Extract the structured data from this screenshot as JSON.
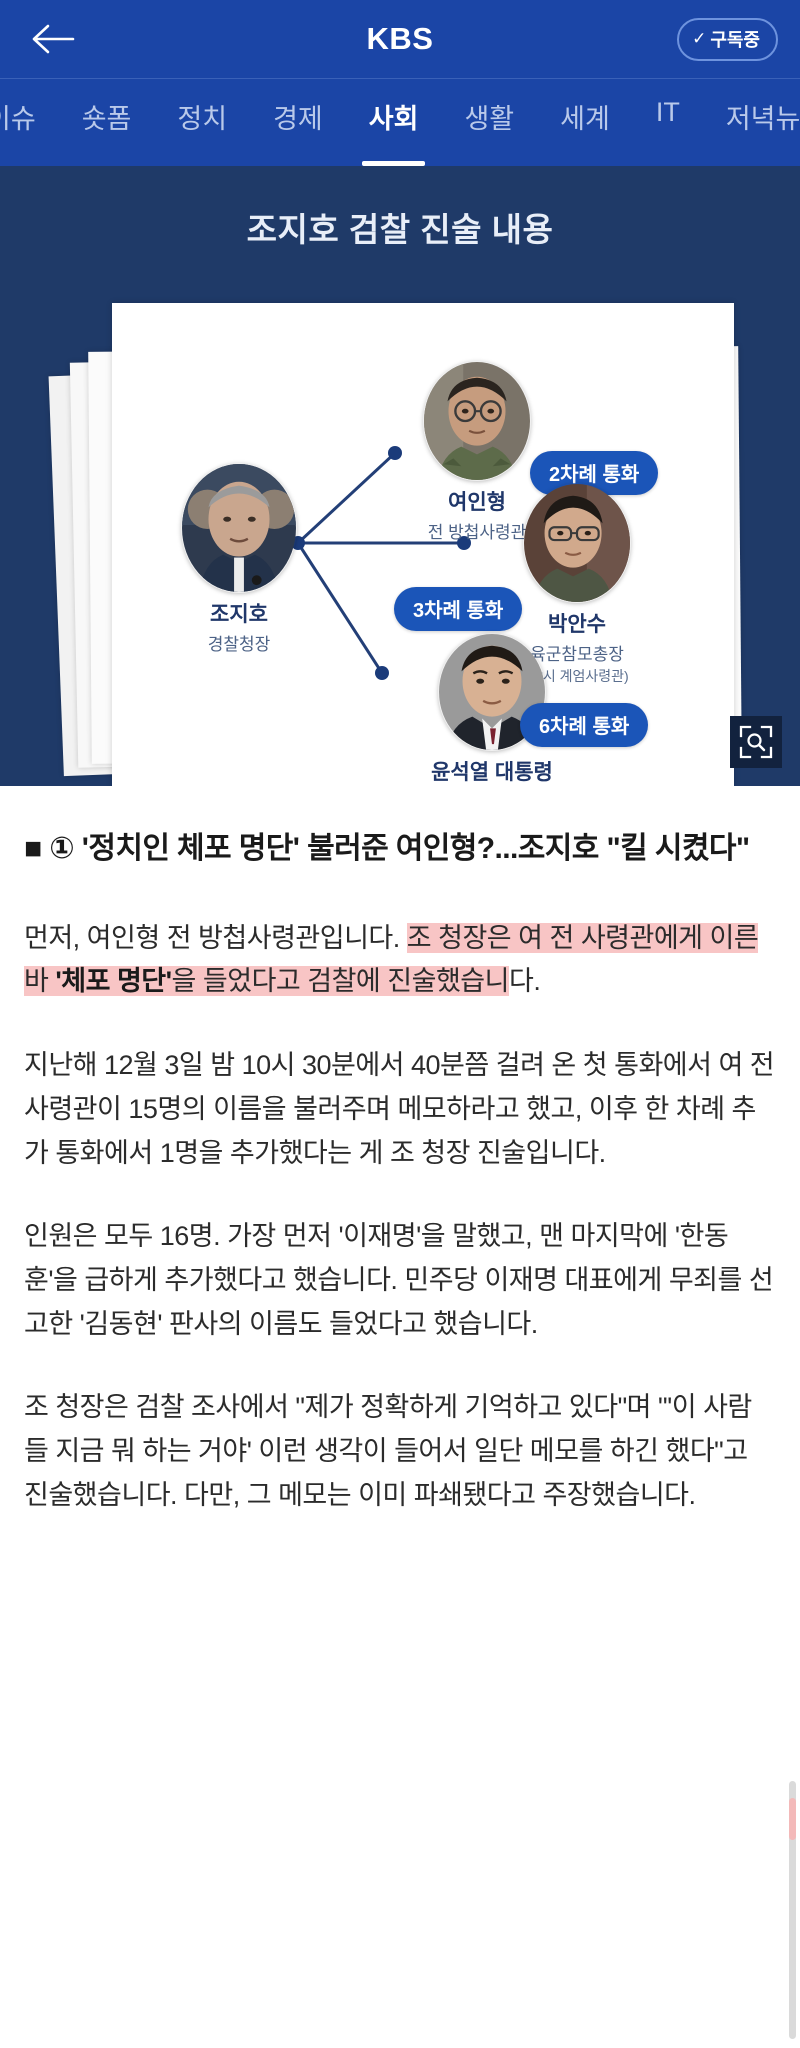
{
  "header": {
    "back_icon": "arrow-left-icon",
    "title": "KBS",
    "subscribe_label": "구독중",
    "subscribe_check": "✓",
    "bg_color": "#1B45A6"
  },
  "tabs": [
    {
      "label": "이슈",
      "active": false,
      "clipped": true
    },
    {
      "label": "숏폼",
      "active": false
    },
    {
      "label": "정치",
      "active": false
    },
    {
      "label": "경제",
      "active": false
    },
    {
      "label": "사회",
      "active": true
    },
    {
      "label": "생활",
      "active": false
    },
    {
      "label": "세계",
      "active": false
    },
    {
      "label": "IT",
      "active": false
    },
    {
      "label": "저녁뉴스",
      "active": false
    }
  ],
  "infographic": {
    "title": "조지호 검찰 진술 내용",
    "bg_color": "#1F3A68",
    "accent_color": "#1B55B8",
    "zoom_icon": "expand-search-icon",
    "source_node": {
      "name": "조지호",
      "role": "경찰청장"
    },
    "targets": [
      {
        "name": "여인형",
        "role": "전 방첩사령관",
        "sub": "",
        "badge": "2차례 통화"
      },
      {
        "name": "박안수",
        "role": "육군참모총장",
        "sub": "(당시 계엄사령관)",
        "badge": "3차례 통화"
      },
      {
        "name": "윤석열 대통령",
        "role": "",
        "sub": "",
        "badge": "6차례 통화"
      }
    ]
  },
  "article": {
    "heading": "■ ① '정치인 체포 명단' 불러준 여인형?...조지호 \"킬 시켰다\"",
    "paragraph_1": {
      "plain_before": "먼저, 여인형 전 방첩사령관입니다. ",
      "highlight_1": "조 청장은 여 전 사령관에게 이른바 ",
      "highlight_bold": "'체포 명단'",
      "highlight_2": "을 들었다고 검찰에 진술했습니",
      "plain_after": "다."
    },
    "paragraph_2": "지난해 12월 3일 밤 10시 30분에서 40분쯤 걸려 온 첫 통화에서 여 전 사령관이 15명의 이름을 불러주며 메모하라고 했고, 이후 한 차례 추가 통화에서 1명을 추가했다는 게 조 청장 진술입니다.",
    "paragraph_3": "인원은 모두 16명. 가장 먼저 '이재명'을 말했고, 맨 마지막에 '한동훈'을 급하게 추가했다고 했습니다. 민주당 이재명 대표에게 무죄를 선고한 '김동현' 판사의 이름도 들었다고 했습니다.",
    "paragraph_4": "조 청장은 검찰 조사에서 \"제가 정확하게 기억하고 있다\"며 \"'이 사람들 지금 뭐 하는 거야' 이런 생각이 들어서 일단 메모를 하긴 했다\"고 진술했습니다. 다만, 그 메모는 이미 파쇄됐다고 주장했습니다.",
    "highlight_color": "#F8C5C5"
  }
}
